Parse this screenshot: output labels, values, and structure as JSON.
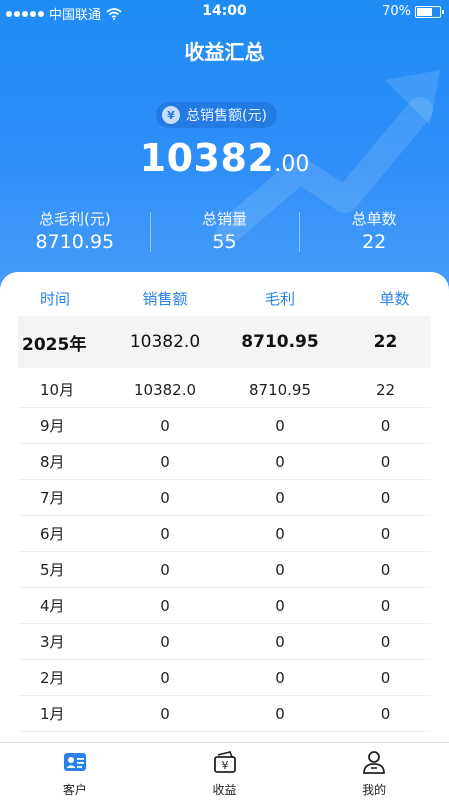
{
  "statusbar": {
    "carrier": "中国联通",
    "time": "14:00",
    "battery_text": "70%",
    "battery_level": 0.7
  },
  "header": {
    "title": "收益汇总"
  },
  "summary": {
    "sales_label": "总销售额(元)",
    "total_int": "10382",
    "total_dec": ".00",
    "stats": [
      {
        "label": "总毛利(元)",
        "value": "8710.95"
      },
      {
        "label": "总销量",
        "value": "55"
      },
      {
        "label": "总单数",
        "value": "22"
      }
    ]
  },
  "table": {
    "headers": [
      "时间",
      "销售额",
      "毛利",
      "单数"
    ],
    "year_row": {
      "period": "2025年",
      "sales": "10382.0",
      "profit": "8710.95",
      "orders": "22"
    },
    "rows": [
      {
        "period": "10月",
        "sales": "10382.0",
        "profit": "8710.95",
        "orders": "22"
      },
      {
        "period": "9月",
        "sales": "0",
        "profit": "0",
        "orders": "0"
      },
      {
        "period": "8月",
        "sales": "0",
        "profit": "0",
        "orders": "0"
      },
      {
        "period": "7月",
        "sales": "0",
        "profit": "0",
        "orders": "0"
      },
      {
        "period": "6月",
        "sales": "0",
        "profit": "0",
        "orders": "0"
      },
      {
        "period": "5月",
        "sales": "0",
        "profit": "0",
        "orders": "0"
      },
      {
        "period": "4月",
        "sales": "0",
        "profit": "0",
        "orders": "0"
      },
      {
        "period": "3月",
        "sales": "0",
        "profit": "0",
        "orders": "0"
      },
      {
        "period": "2月",
        "sales": "0",
        "profit": "0",
        "orders": "0"
      },
      {
        "period": "1月",
        "sales": "0",
        "profit": "0",
        "orders": "0"
      }
    ]
  },
  "tabbar": {
    "items": [
      {
        "label": "客户",
        "icon": "customer-card-icon"
      },
      {
        "label": "收益",
        "icon": "income-yen-icon"
      },
      {
        "label": "我的",
        "icon": "profile-person-icon"
      }
    ]
  },
  "colors": {
    "accent": "#2a82e8",
    "hero_top": "#1f8cf6",
    "hero_bottom": "#4a9ef9"
  }
}
